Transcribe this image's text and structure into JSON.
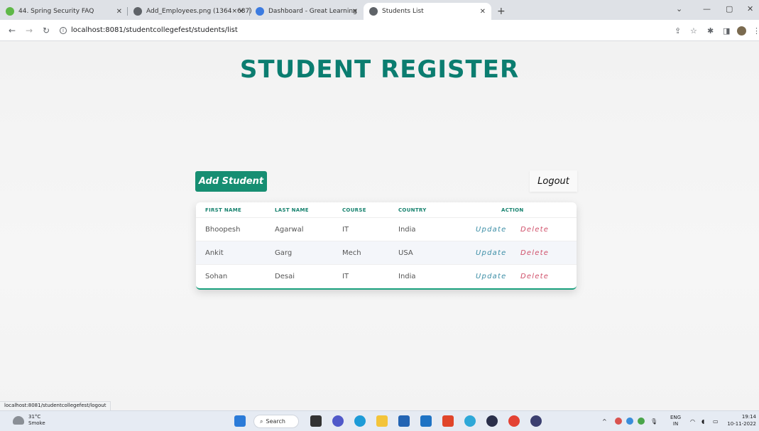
{
  "browser": {
    "tabs": [
      {
        "title": "44. Spring Security FAQ",
        "color": "#5fb848"
      },
      {
        "title": "Add_Employees.png (1364×687)",
        "color": "#5f6368"
      },
      {
        "title": "Dashboard - Great Learning",
        "color": "#3c7be0"
      },
      {
        "title": "Students List",
        "color": "#5f6368"
      }
    ],
    "url": "localhost:8081/studentcollegefest/students/list",
    "status_link": "localhost:8081/studentcollegefest/logout"
  },
  "page": {
    "title": "STUDENT REGISTER",
    "add_label": "Add Student",
    "logout_label": "Logout",
    "columns": [
      "FIRST NAME",
      "LAST NAME",
      "COURSE",
      "COUNTRY",
      "ACTION"
    ],
    "rows": [
      {
        "first": "Bhoopesh",
        "last": "Agarwal",
        "course": "IT",
        "country": "India"
      },
      {
        "first": "Ankit",
        "last": "Garg",
        "course": "Mech",
        "country": "USA"
      },
      {
        "first": "Sohan",
        "last": "Desai",
        "course": "IT",
        "country": "India"
      }
    ],
    "update_label": "Update",
    "delete_label": "Delete"
  },
  "taskbar": {
    "temp": "31°C",
    "weather": "Smoke",
    "search": "Search",
    "lang": "ENG",
    "region": "IN",
    "time": "19:14",
    "date": "10-11-2022"
  },
  "colors": {
    "accent": "#168e72",
    "title": "#0b7d70",
    "update": "#3c8ea6",
    "delete": "#d0506a"
  }
}
